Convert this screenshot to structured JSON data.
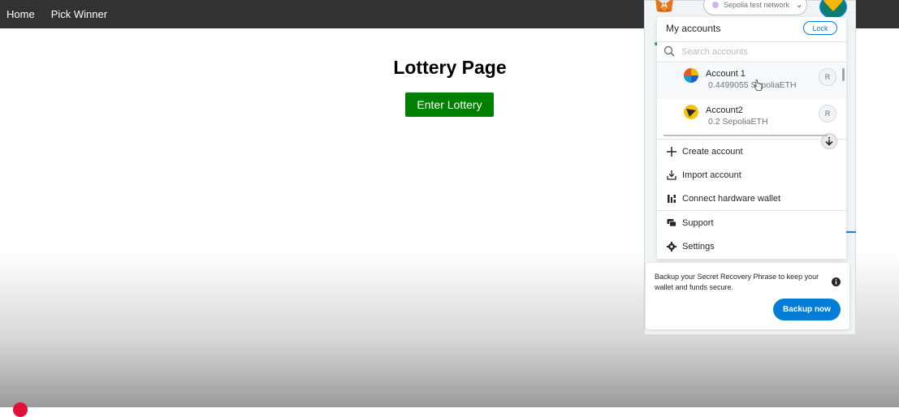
{
  "navbar": {
    "home": "Home",
    "pick_winner": "Pick Winner"
  },
  "main": {
    "title": "Lottery Page",
    "enter_button": "Enter Lottery"
  },
  "colors": {
    "navbar": "#333333",
    "enter_button": "#008000",
    "metamask_accent": "#037dd6"
  },
  "metamask": {
    "network": "Sepolia test network",
    "panel_title": "My accounts",
    "lock_label": "Lock",
    "search_placeholder": "Search accounts",
    "accounts": [
      {
        "name": "Account 1",
        "balance": "0.4499055 SepoliaETH",
        "badge": "R",
        "identicon": "multicolor-pie"
      },
      {
        "name": "Account2",
        "balance": "0.2 SepoliaETH",
        "badge": "R",
        "identicon": "yellow-black"
      }
    ],
    "menu": [
      {
        "label": "Create account",
        "icon": "plus-icon"
      },
      {
        "label": "Import account",
        "icon": "download-icon"
      },
      {
        "label": "Connect hardware wallet",
        "icon": "hardware-icon"
      }
    ],
    "menu2": [
      {
        "label": "Support",
        "icon": "chat-icon"
      },
      {
        "label": "Settings",
        "icon": "gear-icon"
      }
    ],
    "backup_text": "Backup your Secret Recovery Phrase to keep your wallet and funds secure.",
    "backup_button": "Backup now"
  }
}
